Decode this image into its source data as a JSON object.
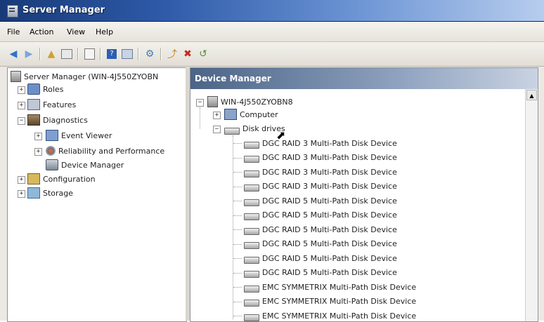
{
  "window": {
    "title": "Server Manager"
  },
  "menu": {
    "file": "File",
    "action": "Action",
    "view": "View",
    "help": "Help"
  },
  "toolbar": {
    "buttons": [
      "back-arrow-icon",
      "forward-arrow-icon",
      "up-folder-icon",
      "show-hide-tree-icon",
      "properties-icon",
      "help-icon",
      "console-icon",
      "scan-hardware-icon",
      "update-driver-icon",
      "disable-device-icon",
      "rollback-icon"
    ]
  },
  "left_tree": {
    "root": "Server Manager (WIN-4J550ZYOBN",
    "roles": "Roles",
    "features": "Features",
    "diagnostics": "Diagnostics",
    "event_viewer": "Event Viewer",
    "reliability": "Reliability and Performance",
    "device_manager": "Device Manager",
    "configuration": "Configuration",
    "storage": "Storage"
  },
  "right_pane": {
    "header": "Device Manager",
    "host": "WIN-4J550ZYOBN8",
    "computer": "Computer",
    "disk_drives": "Disk drives",
    "devices": [
      "DGC RAID 3  Multi-Path Disk Device",
      "DGC RAID 3  Multi-Path Disk Device",
      "DGC RAID 3  Multi-Path Disk Device",
      "DGC RAID 3  Multi-Path Disk Device",
      "DGC RAID 5  Multi-Path Disk Device",
      "DGC RAID 5  Multi-Path Disk Device",
      "DGC RAID 5  Multi-Path Disk Device",
      "DGC RAID 5  Multi-Path Disk Device",
      "DGC RAID 5  Multi-Path Disk Device",
      "DGC RAID 5  Multi-Path Disk Device",
      "EMC SYMMETRIX  Multi-Path Disk Device",
      "EMC SYMMETRIX  Multi-Path Disk Device",
      "EMC SYMMETRIX  Multi-Path Disk Device"
    ]
  }
}
